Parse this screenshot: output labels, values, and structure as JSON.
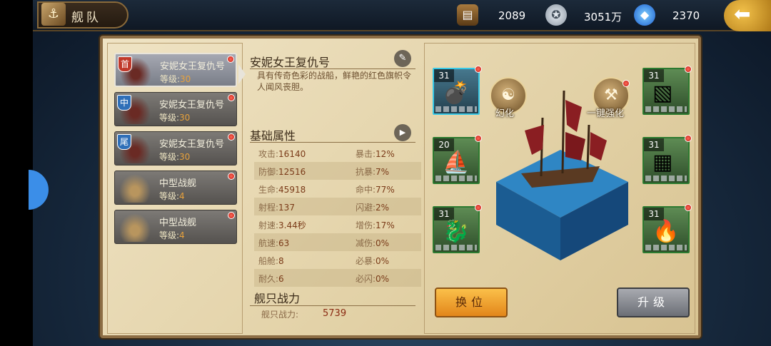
{
  "header": {
    "title": "舰队",
    "resources": [
      {
        "name": "wood",
        "icon": "wood-icon",
        "value": "2089"
      },
      {
        "name": "silver",
        "icon": "silver-coin-icon",
        "value": "3051万"
      },
      {
        "name": "gem",
        "icon": "blue-gem-icon",
        "value": "2370"
      }
    ]
  },
  "ships": [
    {
      "badge": "首",
      "badge_color": "#c0392b",
      "name": "安妮女王复仇号",
      "level_label": "等级:",
      "level": "30",
      "selected": true
    },
    {
      "badge": "中",
      "badge_color": "#2f6fb8",
      "name": "安妮女王复仇号",
      "level_label": "等级:",
      "level": "30",
      "selected": false
    },
    {
      "badge": "尾",
      "badge_color": "#2f6fb8",
      "name": "安妮女王复仇号",
      "level_label": "等级:",
      "level": "30",
      "selected": false
    },
    {
      "badge": "",
      "name": "中型战舰",
      "level_label": "等级:",
      "level": "4",
      "selected": false
    },
    {
      "badge": "",
      "name": "中型战舰",
      "level_label": "等级:",
      "level": "4",
      "selected": false
    }
  ],
  "detail": {
    "ship_name": "安妮女王复仇号",
    "description": "具有传奇色彩的战船，鲜艳的红色旗帜令人闻风丧胆。",
    "basic_title": "基础属性",
    "stats": [
      [
        "攻击:",
        "16140",
        "暴击:",
        "12%"
      ],
      [
        "防御:",
        "12516",
        "抗暴:",
        "7%"
      ],
      [
        "生命:",
        "45918",
        "命中:",
        "77%"
      ],
      [
        "射程:",
        "137",
        "闪避:",
        "2%"
      ],
      [
        "射速:",
        "3.44秒",
        "增伤:",
        "17%"
      ],
      [
        "航速:",
        "63",
        "减伤:",
        "0%"
      ],
      [
        "船舱:",
        "8",
        "必暴:",
        "0%"
      ],
      [
        "耐久:",
        "6",
        "必闪:",
        "0%"
      ]
    ],
    "power_title": "舰只战力",
    "power_label": "舰只战力:",
    "power_value": "5739"
  },
  "equipment": [
    {
      "level": "31",
      "icon": "cannon-icon",
      "frame": "cyan"
    },
    {
      "level": "20",
      "icon": "sail-icon",
      "frame": "green"
    },
    {
      "level": "31",
      "icon": "figurehead-icon",
      "frame": "green"
    },
    {
      "level": "31",
      "icon": "plank-icon",
      "frame": "green"
    },
    {
      "level": "31",
      "icon": "crate-icon",
      "frame": "green"
    },
    {
      "level": "31",
      "icon": "flame-scroll-icon",
      "frame": "green"
    }
  ],
  "actions": {
    "transform": "幻化",
    "auto_enhance": "一键强化",
    "swap": "换位",
    "upgrade": "升级"
  }
}
